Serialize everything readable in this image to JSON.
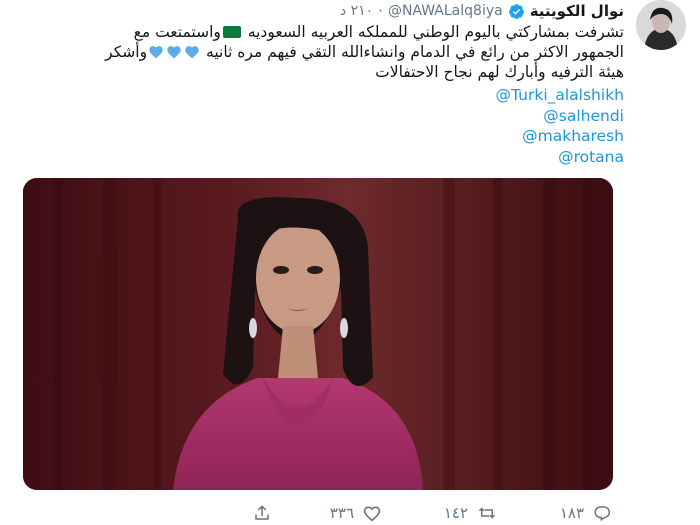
{
  "tweet": {
    "display_name": "نوال الكويتية",
    "handle": "NAWALalq8iya@",
    "time": "٢١٠ د",
    "body_lines": [
      "تشرفت بمشاركتي باليوم الوطني للمملكه العربيه السعوديه",
      "واستمتعت مع",
      "الجمهور الاكثر من رائع في الدمام وانشاءالله التقي فيهم مره ثانيه",
      "وأشكر",
      "هيئة الترفيه وأبارك لهم نجاح الاحتفالات"
    ],
    "mentions": [
      "@Turki_alalshikh",
      "@salhendi",
      "@makharesh",
      "@rotana"
    ],
    "actions": {
      "reply_count": "١٨٣",
      "retweet_count": "١٤٢",
      "like_count": "٣٣٦"
    }
  },
  "colors": {
    "link": "#1b95e0",
    "verified": "#1da1f2",
    "heart": "#5dadec",
    "muted": "#657786"
  },
  "icons": [
    "verified-badge-icon",
    "saudi-flag-icon",
    "blue-heart-icon",
    "reply-icon",
    "retweet-icon",
    "like-icon",
    "share-icon"
  ]
}
